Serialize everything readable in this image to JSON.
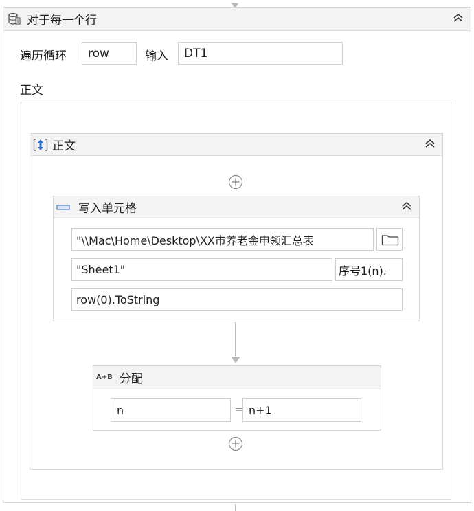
{
  "foreach": {
    "title": "对于每一个行",
    "loop_label": "遍历循环",
    "loop_var": "row",
    "input_label": "输入",
    "input_value": "DT1",
    "body_label": "正文"
  },
  "sequence": {
    "title": "正文"
  },
  "write_cell": {
    "title": "写入单元格",
    "workbook_path": "\"\\\\Mac\\Home\\Desktop\\XX市养老金申领汇总表",
    "sheet": "\"Sheet1\"",
    "cell": "序号1(n).",
    "value": "row(0).ToString"
  },
  "assign": {
    "title": "分配",
    "icon_text": "A+B",
    "left": "n",
    "equals": "=",
    "right": "n+1"
  },
  "icons": {
    "foreach": "database-loop-icon",
    "sequence": "sequence-icon",
    "write_cell": "cell-icon",
    "assign": "assign-icon",
    "folder": "folder-icon",
    "collapse": "double-chevron-up-icon",
    "add": "add-circle-icon"
  },
  "colors": {
    "header_bg": "#f3f3f3",
    "border": "#d6d6d6",
    "accent_blue": "#2f6fcf"
  }
}
